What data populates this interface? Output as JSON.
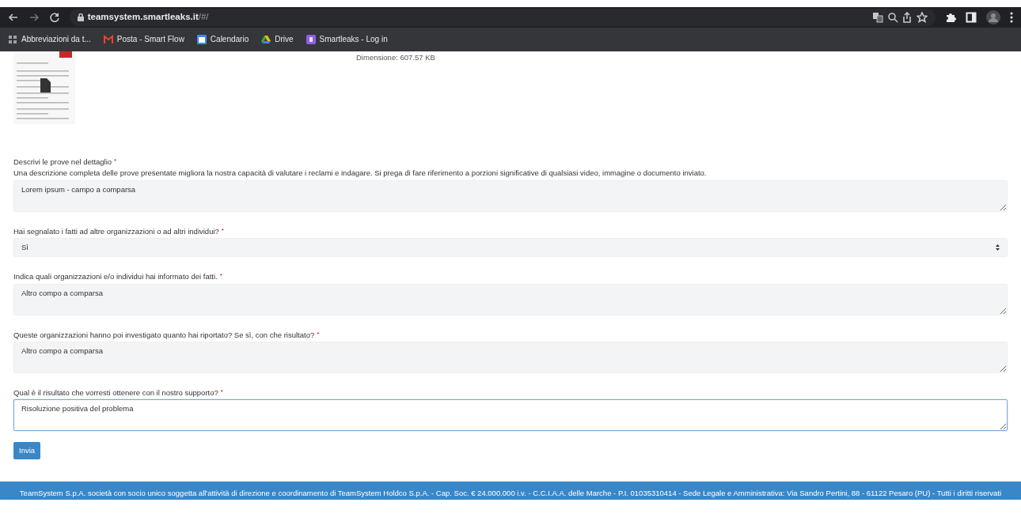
{
  "browser": {
    "url_host": "teamsystem.smartleaks.it",
    "url_path": "/#/",
    "bookmarks": [
      {
        "label": "Abbreviazioni da t..."
      },
      {
        "label": "Posta - Smart Flow"
      },
      {
        "label": "Calendario"
      },
      {
        "label": "Drive"
      },
      {
        "label": "Smartleaks - Log in"
      }
    ]
  },
  "attachment": {
    "size": "Dimensione: 607.57 KB"
  },
  "form": {
    "fields": [
      {
        "kind": "textarea",
        "label": "Descrivi le prove nel dettaglio",
        "required_mark": "*",
        "help": "Una descrizione completa delle prove presentate migliora la nostra capacità di valutare i reclami e indagare. Si prega di fare riferimento a porzioni significative di qualsiasi video, immagine o documento inviato.",
        "value": "Lorem ipsum - campo a comparsa",
        "focused": false
      },
      {
        "kind": "select",
        "label": "Hai segnalato i fatti ad altre organizzazioni o ad altri individui?",
        "required_mark": "*",
        "value": "Sì",
        "focused": false
      },
      {
        "kind": "textarea",
        "label": "Indica quali organizzazioni e/o individui hai informato dei fatti.",
        "required_mark": "*",
        "value": "Altro compo a comparsa",
        "focused": false
      },
      {
        "kind": "textarea",
        "label": "Queste organizzazioni hanno poi investigato quanto hai riportato? Se sì, con che risultato?",
        "required_mark": "*",
        "value": "Altro compo a comparsa",
        "focused": false
      },
      {
        "kind": "textarea",
        "label": "Qual è il risultato che vorresti ottenere con il nostro supporto?",
        "required_mark": "*",
        "value": "Risoluzione positiva del problema",
        "focused": true
      }
    ],
    "submit": "Invia"
  },
  "footer": {
    "text": "TeamSystem S.p.A. società con socio unico soggetta all'attività di direzione e coordinamento di TeamSystem Holdco S.p.A. - Cap. Soc. € 24.000.000 i.v. - C.C.I.A.A. delle Marche - P.I. 01035310414 - Sede Legale e Amministrativa: Via Sandro Pertini, 88 - 61122 Pesaro (PU) - Tutti i diritti riservati"
  }
}
